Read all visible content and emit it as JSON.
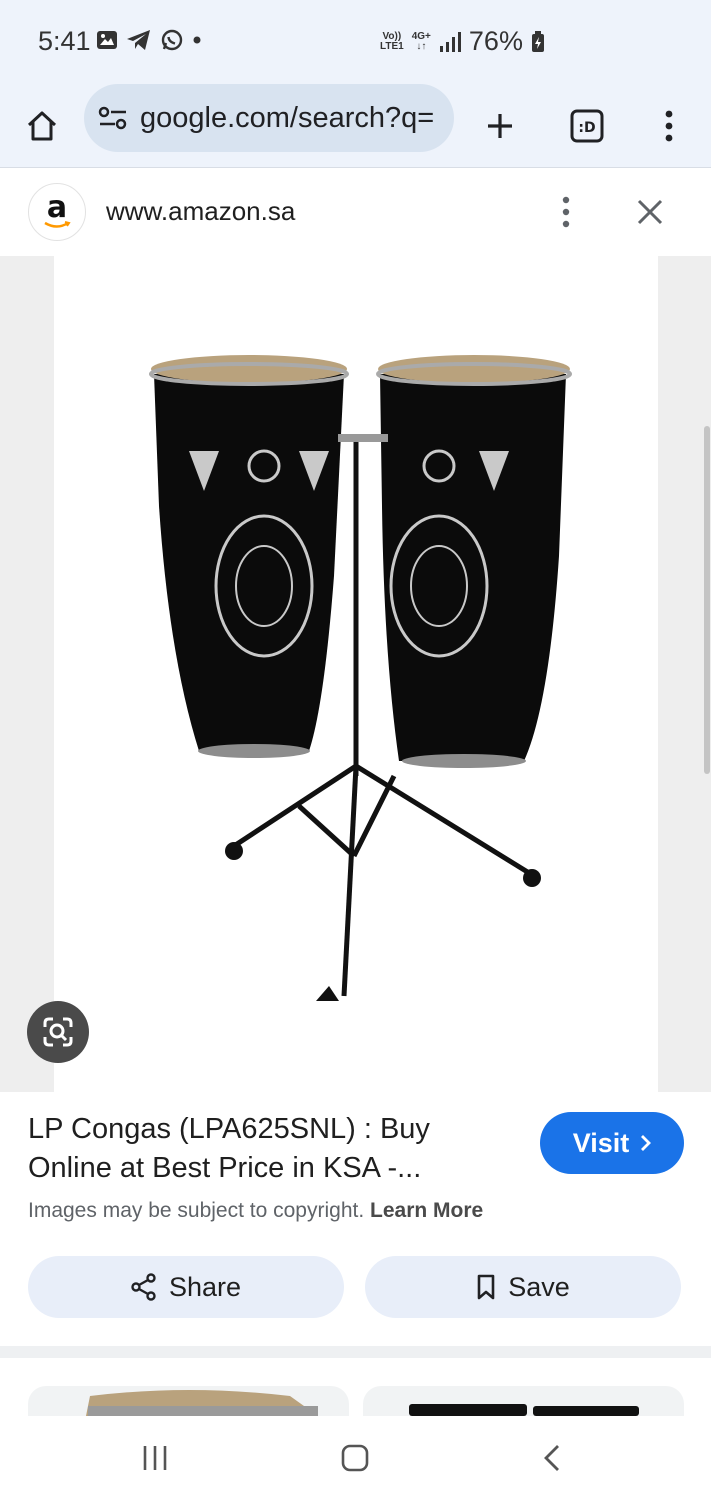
{
  "status_bar": {
    "time": "5:41",
    "volte": "Vo))",
    "lte": "LTE1",
    "net_type": "4G+",
    "battery": "76%"
  },
  "toolbar": {
    "url": "google.com/search?q="
  },
  "source": {
    "site_url": "www.amazon.sa",
    "logo_letter": "a"
  },
  "result": {
    "title": "LP Congas (LPA625SNL) : Buy Online at Best Price in KSA -...",
    "visit_label": "Visit",
    "copyright_text": "Images may be subject to copyright.",
    "learn_more": "Learn More",
    "share_label": "Share",
    "save_label": "Save"
  },
  "colors": {
    "accent": "#1a73e8",
    "toolbar_bg": "#eef3fb",
    "pill_bg": "#e8eef9"
  }
}
